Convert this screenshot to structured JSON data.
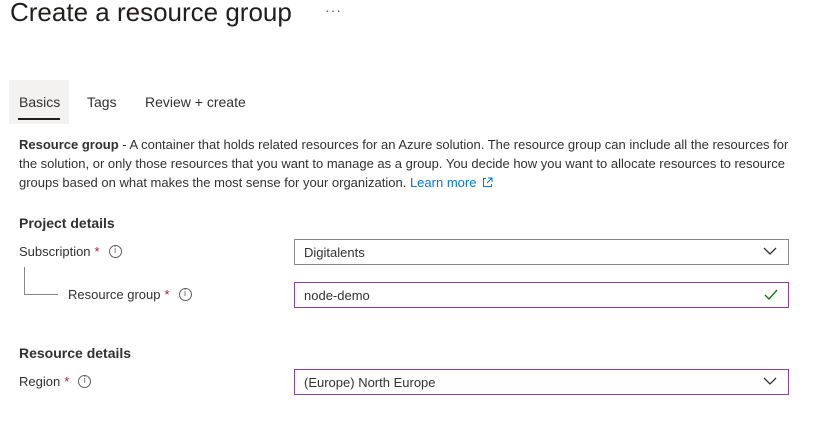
{
  "page": {
    "title": "Create a resource group",
    "more": "···"
  },
  "tabs": [
    {
      "label": "Basics",
      "active": true
    },
    {
      "label": "Tags",
      "active": false
    },
    {
      "label": "Review + create",
      "active": false
    }
  ],
  "description": {
    "bold": "Resource group",
    "text": " - A container that holds related resources for an Azure solution. The resource group can include all the resources for the solution, or only those resources that you want to manage as a group. You decide how you want to allocate resources to resource groups based on what makes the most sense for your organization. ",
    "link": "Learn more"
  },
  "project_details": {
    "heading": "Project details",
    "subscription": {
      "label": "Subscription",
      "required": "*",
      "value": "Digitalents"
    },
    "resource_group": {
      "label": "Resource group",
      "required": "*",
      "value": "node-demo"
    }
  },
  "resource_details": {
    "heading": "Resource details",
    "region": {
      "label": "Region",
      "required": "*",
      "value": "(Europe) North Europe"
    }
  },
  "icons": {
    "info": "info-icon",
    "chevron": "chevron-down-icon",
    "check": "checkmark-icon",
    "external": "external-link-icon"
  },
  "colors": {
    "link": "#0078d4",
    "required": "#a4262c",
    "valid": "#107c10",
    "focus_border": "#8a3fa8"
  }
}
